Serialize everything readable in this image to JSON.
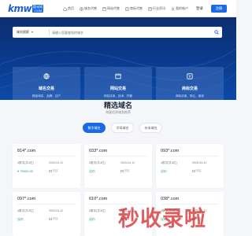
{
  "header": {
    "logo_text": "kmw",
    "logo_badge_top": "酷米网",
    "logo_badge_bottom": ".COM",
    "nav": [
      {
        "label": "首页",
        "icon": "home-icon"
      },
      {
        "label": "域名代售",
        "icon": "globe-icon"
      },
      {
        "label": "网站代售",
        "icon": "browser-icon"
      },
      {
        "label": "商标代售",
        "icon": "trademark-icon"
      },
      {
        "label": "行业资讯",
        "icon": "news-icon"
      },
      {
        "label": "我的账户",
        "icon": "user-icon"
      }
    ],
    "login_label": "登录",
    "register_label": "注册"
  },
  "search": {
    "type_label": "域名搜索",
    "placeholder": "请输入您要查找的域名",
    "button_icon": "search-icon"
  },
  "categories": [
    {
      "title": "域名交易",
      "subtitle": "精品域名、品牌、过户",
      "icon": "globe-icon"
    },
    {
      "title": "网站交易",
      "subtitle": "网站买卖、技术、托管",
      "icon": "browser-icon"
    },
    {
      "title": "商标交易",
      "subtitle": "商标买卖、转让、维权",
      "icon": "trademark-icon"
    }
  ],
  "section": {
    "title": "精选域名",
    "subtitle": "海量优质域名推荐",
    "tabs": [
      {
        "label": "数字域名",
        "active": true
      },
      {
        "label": "字母域名",
        "active": false
      },
      {
        "label": "杂米域名",
        "active": false
      }
    ]
  },
  "domains": [
    {
      "name": "814*.com",
      "length": "4数字(共4位)",
      "date": "2025-04-12",
      "price": "¥ 78000.00",
      "bid": "可议"
    },
    {
      "name": "033*.com",
      "length": "4数字(共4位)",
      "date": "2025-04-12",
      "price": "议价",
      "bid": "可议"
    },
    {
      "name": "093*.com",
      "length": "4数字(共4位)",
      "date": "2025-04-12",
      "price": "议价",
      "bid": "可议"
    },
    {
      "name": "097*.com",
      "length": "4数字(共4位)",
      "date": "2025-04-12",
      "price": "议价",
      "bid": "可议"
    },
    {
      "name": "610*.com",
      "length": "4数字(共4位)",
      "date": "2025-04-12",
      "price": "议价",
      "bid": "可议"
    },
    {
      "name": "038*.com",
      "length": "4数字(共4位)",
      "date": "2025-04-12",
      "price": "议价",
      "bid": "可议"
    }
  ],
  "watermark": "秒收录啦",
  "colors": {
    "accent": "#1a6ae6",
    "hero": "#0a3a8c",
    "price": "#2aa36a"
  }
}
